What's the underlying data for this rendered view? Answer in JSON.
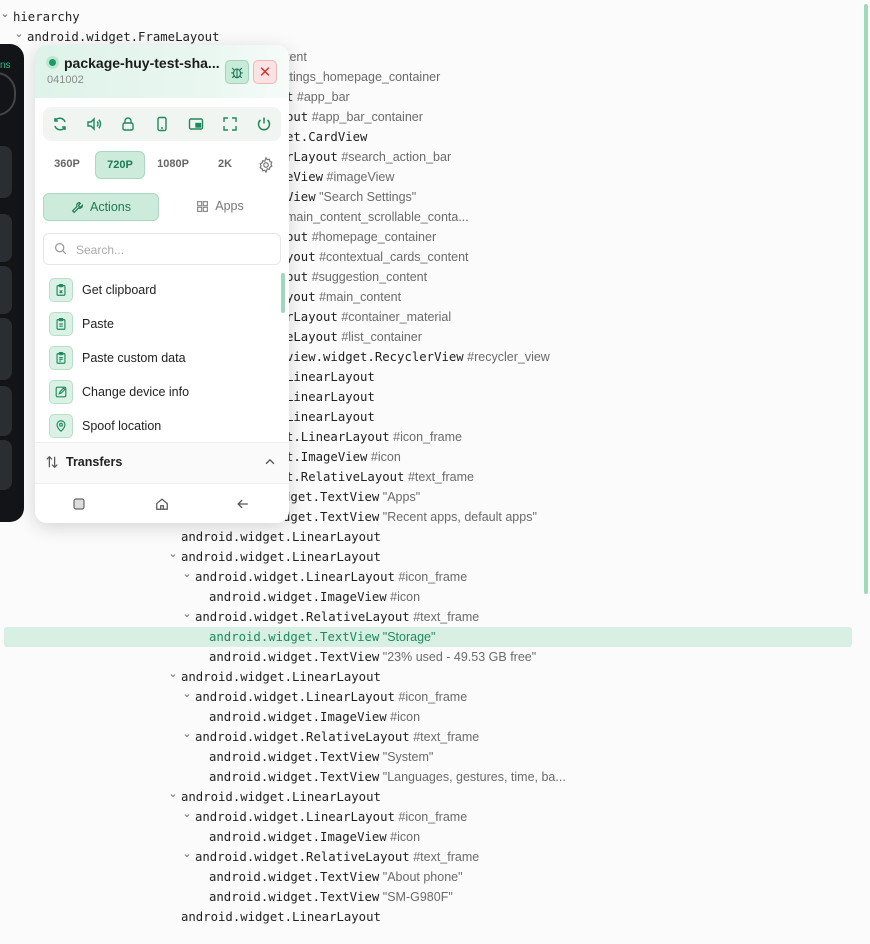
{
  "tree": {
    "rows": [
      {
        "cls": "hierarchy",
        "attr": "",
        "indent": 0,
        "chev": true
      },
      {
        "cls": "android.widget.FrameLayout",
        "attr": "",
        "indent": 1,
        "chev": true
      },
      {
        "cls": "",
        "attr": "tent",
        "indent": 19.5,
        "chev": false
      },
      {
        "cls": "",
        "attr": "ttings_homepage_container",
        "indent": 19.5,
        "chev": false
      },
      {
        "cls": "t",
        "attr": "#app_bar",
        "indent": 19.5,
        "chev": false
      },
      {
        "cls": "out",
        "attr": "#app_bar_container",
        "indent": 19.5,
        "chev": false
      },
      {
        "cls": "et.CardView",
        "attr": "",
        "indent": 19.5,
        "chev": false
      },
      {
        "cls": "rLayout",
        "attr": "#search_action_bar",
        "indent": 19.5,
        "chev": false
      },
      {
        "cls": "eView",
        "attr": "#imageView",
        "indent": 19.5,
        "chev": false
      },
      {
        "cls": "View",
        "attr": "\"Search Settings\"",
        "indent": 19.5,
        "chev": false
      },
      {
        "cls": "",
        "attr": "main_content_scrollable_conta...",
        "indent": 19.5,
        "chev": false
      },
      {
        "cls": "out",
        "attr": "#homepage_container",
        "indent": 19.5,
        "chev": false
      },
      {
        "cls": "yout",
        "attr": "#contextual_cards_content",
        "indent": 19.5,
        "chev": false
      },
      {
        "cls": "out",
        "attr": "#suggestion_content",
        "indent": 19.5,
        "chev": false
      },
      {
        "cls": "yout",
        "attr": "#main_content",
        "indent": 19.5,
        "chev": false
      },
      {
        "cls": "rLayout",
        "attr": "#container_material",
        "indent": 19.5,
        "chev": false
      },
      {
        "cls": "eLayout",
        "attr": "#list_container",
        "indent": 19.5,
        "chev": false
      },
      {
        "cls": "view.widget.RecyclerView",
        "attr": "#recycler_view",
        "indent": 19.5,
        "chev": false
      },
      {
        "cls": "LinearLayout",
        "attr": "",
        "indent": 19.5,
        "chev": false
      },
      {
        "cls": "LinearLayout",
        "attr": "",
        "indent": 19.5,
        "chev": false
      },
      {
        "cls": "LinearLayout",
        "attr": "",
        "indent": 19.5,
        "chev": false
      },
      {
        "cls": "t.LinearLayout",
        "attr": "#icon_frame",
        "indent": 19.5,
        "chev": false
      },
      {
        "cls": "t.ImageView",
        "attr": "#icon",
        "indent": 19.5,
        "chev": false
      },
      {
        "cls": "t.RelativeLayout",
        "attr": "#text_frame",
        "indent": 19.5,
        "chev": false
      },
      {
        "cls": "android.widget.TextView",
        "attr": "\"Apps\"",
        "indent": 14,
        "chev": false
      },
      {
        "cls": "android.widget.TextView",
        "attr": "\"Recent apps, default apps\"",
        "indent": 14,
        "chev": false
      },
      {
        "cls": "android.widget.LinearLayout",
        "attr": "",
        "indent": 12,
        "chev": false
      },
      {
        "cls": "android.widget.LinearLayout",
        "attr": "",
        "indent": 12,
        "chev": true
      },
      {
        "cls": "android.widget.LinearLayout",
        "attr": "#icon_frame",
        "indent": 13,
        "chev": true
      },
      {
        "cls": "android.widget.ImageView",
        "attr": "#icon",
        "indent": 14,
        "chev": false
      },
      {
        "cls": "android.widget.RelativeLayout",
        "attr": "#text_frame",
        "indent": 13,
        "chev": true
      },
      {
        "cls": "android.widget.TextView",
        "attr": "\"Storage\"",
        "indent": 14,
        "chev": false,
        "selected": true
      },
      {
        "cls": "android.widget.TextView",
        "attr": "\"23% used - 49.53 GB free\"",
        "indent": 14,
        "chev": false
      },
      {
        "cls": "android.widget.LinearLayout",
        "attr": "",
        "indent": 12,
        "chev": true
      },
      {
        "cls": "android.widget.LinearLayout",
        "attr": "#icon_frame",
        "indent": 13,
        "chev": true
      },
      {
        "cls": "android.widget.ImageView",
        "attr": "#icon",
        "indent": 14,
        "chev": false
      },
      {
        "cls": "android.widget.RelativeLayout",
        "attr": "#text_frame",
        "indent": 13,
        "chev": true
      },
      {
        "cls": "android.widget.TextView",
        "attr": "\"System\"",
        "indent": 14,
        "chev": false
      },
      {
        "cls": "android.widget.TextView",
        "attr": "\"Languages, gestures, time, ba...",
        "indent": 14,
        "chev": false
      },
      {
        "cls": "android.widget.LinearLayout",
        "attr": "",
        "indent": 12,
        "chev": true
      },
      {
        "cls": "android.widget.LinearLayout",
        "attr": "#icon_frame",
        "indent": 13,
        "chev": true
      },
      {
        "cls": "android.widget.ImageView",
        "attr": "#icon",
        "indent": 14,
        "chev": false
      },
      {
        "cls": "android.widget.RelativeLayout",
        "attr": "#text_frame",
        "indent": 13,
        "chev": true
      },
      {
        "cls": "android.widget.TextView",
        "attr": "\"About phone\"",
        "indent": 14,
        "chev": false
      },
      {
        "cls": "android.widget.TextView",
        "attr": "\"SM-G980F\"",
        "indent": 14,
        "chev": false
      },
      {
        "cls": "android.widget.LinearLayout",
        "attr": "",
        "indent": 12,
        "chev": false
      }
    ]
  },
  "phone": {
    "partial_text": "ns"
  },
  "panel": {
    "title": "package-huy-test-sha...",
    "subtitle": "041002",
    "bug_icon": "bug-icon",
    "close_icon": "close-icon",
    "toolbar": [
      "rotate-icon",
      "volume-icon",
      "lock-icon",
      "phone-icon",
      "picture-in-picture-icon",
      "fullscreen-icon",
      "power-icon"
    ],
    "resolutions": [
      {
        "label": "360P",
        "active": false
      },
      {
        "label": "720P",
        "active": true
      },
      {
        "label": "1080P",
        "active": false
      },
      {
        "label": "2K",
        "active": false
      }
    ],
    "tabs": {
      "actions": "Actions",
      "apps": "Apps"
    },
    "search": {
      "placeholder": "Search..."
    },
    "actions": [
      {
        "label": "Get clipboard",
        "icon": "clipboard-icon"
      },
      {
        "label": "Paste",
        "icon": "paste-icon"
      },
      {
        "label": "Paste custom data",
        "icon": "paste-custom-icon"
      },
      {
        "label": "Change device info",
        "icon": "edit-icon"
      },
      {
        "label": "Spoof location",
        "icon": "location-pin-icon"
      }
    ],
    "transfers": {
      "label": "Transfers"
    },
    "accent": "#1d8a5c"
  }
}
